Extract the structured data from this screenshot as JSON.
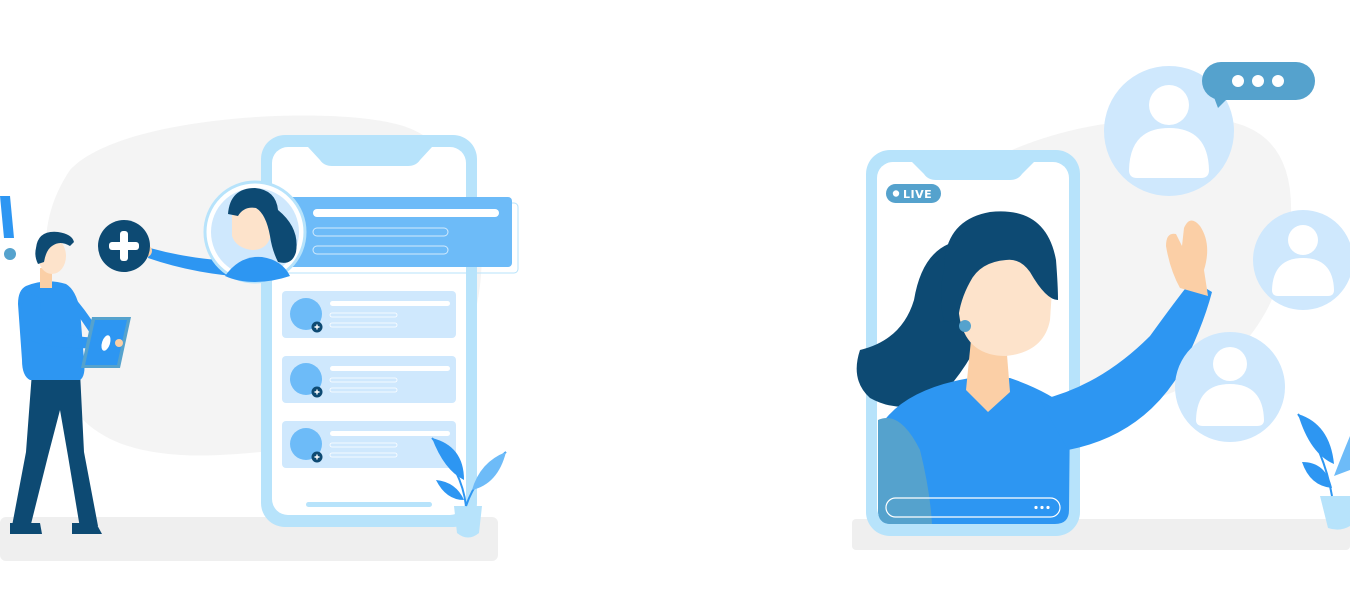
{
  "live_badge": {
    "label": "LIVE"
  },
  "colors": {
    "phone_frame": "#b7e3fb",
    "accent_blue": "#2d96f2",
    "dark_navy": "#0d4a73",
    "light_blue": "#cfe8fd",
    "card_blue": "#6dbbf8",
    "skin": "#fde3cb",
    "hand": "#fbcfa6",
    "background_blob": "#f4f4f4",
    "floor": "#efefef",
    "chat_bubble": "#55a2cd"
  },
  "icons": [
    "add-contact-icon",
    "exclamation-icon",
    "user-avatar-icon",
    "chat-bubble-icon",
    "more-dots-icon"
  ]
}
